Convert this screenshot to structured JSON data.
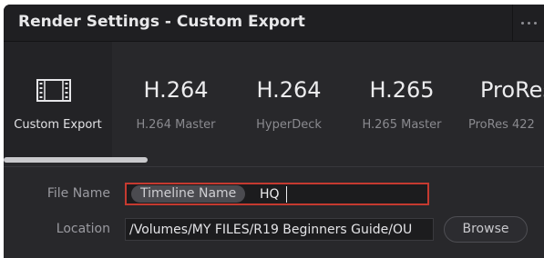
{
  "header": {
    "title": "Render Settings - Custom Export",
    "more_icon": "ellipsis-icon"
  },
  "presets": [
    {
      "icon": "film-strip-icon",
      "label": "",
      "sublabel": "Custom Export",
      "active": true
    },
    {
      "label": "H.264",
      "sublabel": "H.264 Master"
    },
    {
      "label": "H.264",
      "sublabel": "HyperDeck"
    },
    {
      "label": "H.265",
      "sublabel": "H.265 Master"
    },
    {
      "label": "ProRes",
      "sublabel": "ProRes 422"
    }
  ],
  "file_name": {
    "label": "File Name",
    "token": "Timeline Name",
    "value": "HQ"
  },
  "location": {
    "label": "Location",
    "value": "/Volumes/MY FILES/R19 Beginners Guide/OU"
  },
  "browse_label": "Browse",
  "colors": {
    "panel_bg": "#28282b",
    "header_bg": "#1f1f22",
    "active_field_border": "#c53a30"
  }
}
